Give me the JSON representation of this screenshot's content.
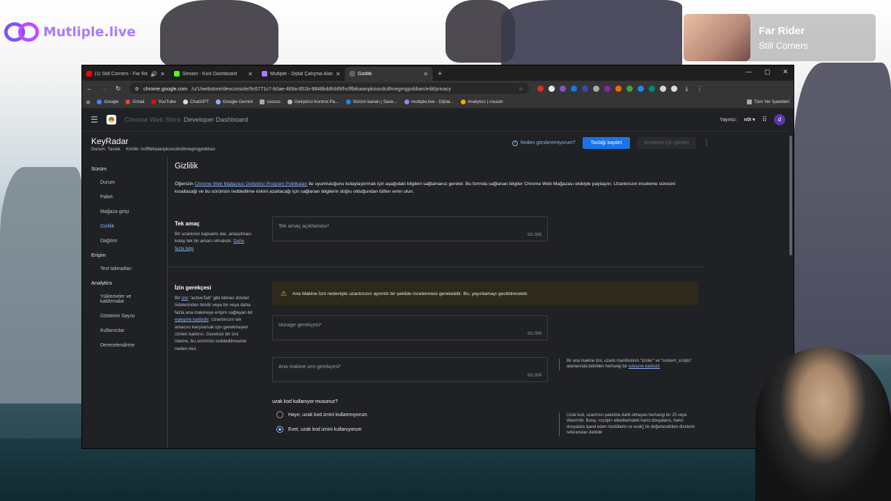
{
  "overlay": {
    "logo_text": "Mutliple.live",
    "now_playing": {
      "title": "Far Rider",
      "artist": "Still Corners"
    }
  },
  "browser": {
    "tabs": [
      {
        "label": "(1) Still Corners - Far Rider |",
        "color": "#ff0000"
      },
      {
        "label": "Stream - Kick Dashboard",
        "color": "#53fc18"
      },
      {
        "label": "Mutliple - Dijital Çalışma Alanın",
        "color": "#a97bff"
      },
      {
        "label": "Gizlilik",
        "color": "#5f6368"
      }
    ],
    "url_host": "chrome.google.com",
    "url_path": "/u/1/webstore/devconsole/9c6771c7-b0ae-469a-851b-9848bddfcbf9/hcflfbikaianpkoocdcdhnegmgpobban/edit/privacy",
    "bookmarks": [
      "Google",
      "Gmail",
      "YouTube",
      "ChatGPT",
      "Google Gemini",
      "ssssss",
      "Geliştirici Kontrol Pa...",
      "Sürüm kanalı | Save...",
      "mutliple.live - Dijital...",
      "Analytics | rocash"
    ],
    "bookmarks_right": "Tüm Yer İşaretleri"
  },
  "app": {
    "title_strong": "Chrome Web Store",
    "title": "Developer Dashboard",
    "publisher_label": "Yayıncı:",
    "publisher_value": "n0t",
    "avatar": "d"
  },
  "item": {
    "name": "KeyRadar",
    "status": "Durum: Taslak",
    "id": "Kimlik: hcflfbikaianpkoocdcdhnegmgpobban",
    "why": "Neden gönderemiyorum?",
    "save": "Taslağı kaydet",
    "review": "İnceleme için gönder"
  },
  "sidebar": {
    "sections": [
      {
        "title": "Sürüm",
        "items": [
          "Durum",
          "Paket",
          "Mağaza girişi",
          "Gizlilik",
          "Dağıtım"
        ]
      },
      {
        "title": "Erişim",
        "items": [
          "Test talimatları"
        ]
      },
      {
        "title": "Analytics",
        "items": [
          "Yüklemeler ve kaldırmalar",
          "Gösterim Sayısı",
          "Kullanıcılar",
          "Derecelendirme"
        ]
      }
    ],
    "active": "Gizlilik"
  },
  "privacy": {
    "heading": "Gizlilik",
    "intro_pre": "Öğenizin ",
    "intro_link": "Chrome Web Mağazası Geliştirici Program Politikaları",
    "intro_post": " ile uyumluluğunu kolaylaştırmak için aşağıdaki bilgileri sağlamanız gerekir. Bu formda sağlanan bilgiler Chrome Web Mağazası ekibiyle paylaşılır. Uzantınızın inceleme süresini kısaltacağı ve bu sürümün reddedilme riskini azaltacağı için sağlanan bilgilerin doğru olduğundan lütfen emin olun.",
    "single_purpose": {
      "label": "Tek amaç",
      "desc": "Bir uzantının kapsamı dar, anlaşılması kolay tek bir amacı olmalıdır. ",
      "link": "Daha fazla bilgi",
      "placeholder": "Tek amaç açıklaması*",
      "counter": "0/1.000"
    },
    "permission": {
      "label": "İzin gerekçesi",
      "desc_1": "Bir ",
      "desc_link1": "izin",
      "desc_2": " \"activeTab\" gibi bilinen dizeler listelerinden biridir veya bir veya daha fazla ana makineye erişim sağlayan bir ",
      "desc_link2": "eşleşme kalıbıdır",
      "desc_3": ". Uzantınızın tek amacını karşılamak için gerekmeyen izinleri kaldırın. Gereksiz bir izni isteme, bu sürümün reddedilmesine neden olur.",
      "warning": "Ana Makine İzni nedeniyle uzantınızın ayrıntılı bir şekilde incelenmesi gerekebilir. Bu, yayınlamayı geciktirecektir.",
      "storage_placeholder": "storage gerekçesi*",
      "storage_counter": "0/1.000",
      "host_placeholder": "Ana makine izni gerekçesi*",
      "host_counter": "0/1.000",
      "host_note": "Bir ana makine izni, uzantı manifestinin \"izinler\" ve \"content_scripts\" alanlarında belirtilen herhangi bir ",
      "host_note_link": "eşleşme kalıbıdır"
    },
    "remote_code": {
      "question": "uzak kod kullanıyor musunuz?",
      "options": [
        "Hayır, uzak kod iznini kullanmıyorum",
        "Evet, uzak kod iznini kullanıyorum"
      ],
      "selected": "Evet, uzak kod iznini kullanıyorum",
      "note": "Uzak kod, uzantının paketine dahil olmayan herhangi bir JS veya Wasm'dir. Buna, <script> etiketlerindeki harici dosyaların, harici dosyalara işaret eden modüllerin ve eval() ile değerlendirilen dizelerin referansları dahildir"
    }
  }
}
